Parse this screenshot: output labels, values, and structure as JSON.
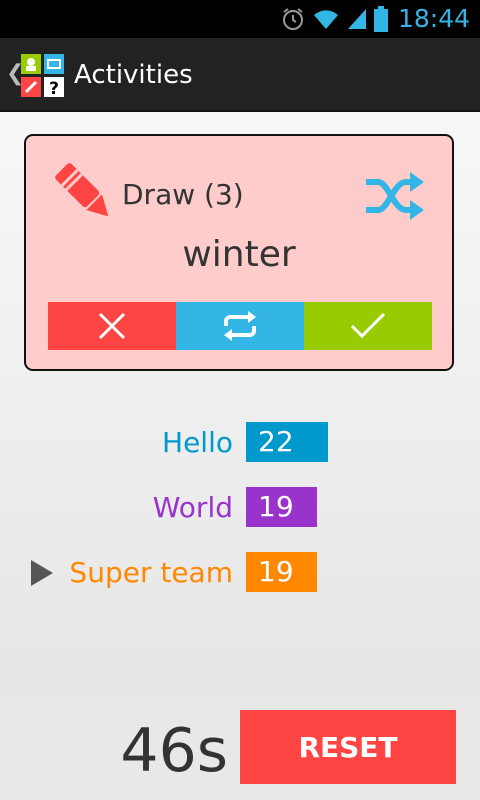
{
  "status_bar": {
    "time": "18:44"
  },
  "action_bar": {
    "title": "Activities"
  },
  "card": {
    "activity_label": "Draw (3)",
    "word": "winter",
    "colors": {
      "background": "#ffcccc",
      "fail": "#ff4444",
      "skip": "#33b5e5",
      "success": "#99cc00"
    }
  },
  "teams": [
    {
      "name": "Hello",
      "score": "22",
      "color": "#0099cc",
      "active": false
    },
    {
      "name": "World",
      "score": "19",
      "color": "#9933cc",
      "active": false
    },
    {
      "name": "Super team",
      "score": "19",
      "color": "#ff8800",
      "active": true
    }
  ],
  "bottom": {
    "timer": "46s",
    "reset_label": "RESET"
  }
}
